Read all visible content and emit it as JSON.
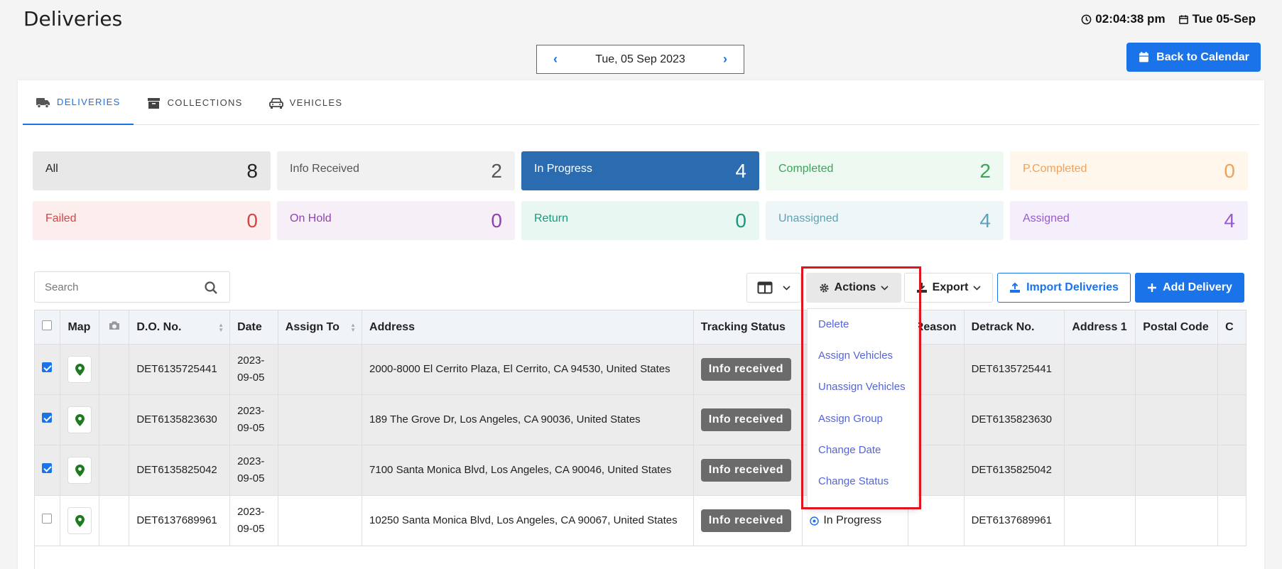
{
  "page": {
    "title": "Deliveries"
  },
  "header": {
    "time": "02:04:38 pm",
    "date": "Tue 05-Sep"
  },
  "date_nav": {
    "label": "Tue, 05 Sep 2023"
  },
  "back_button": {
    "label": "Back to Calendar"
  },
  "tabs": [
    {
      "label": "DELIVERIES",
      "active": true,
      "icon": "truck-icon"
    },
    {
      "label": "COLLECTIONS",
      "active": false,
      "icon": "archive-icon"
    },
    {
      "label": "VEHICLES",
      "active": false,
      "icon": "car-icon"
    }
  ],
  "stats": [
    {
      "label": "All",
      "count": "8",
      "bg": "#e8e8e8",
      "color": "#222222"
    },
    {
      "label": "Info Received",
      "count": "2",
      "bg": "#f1f1f1",
      "color": "#555555"
    },
    {
      "label": "In Progress",
      "count": "4",
      "bg": "#2b6cb0",
      "color": "#ffffff"
    },
    {
      "label": "Completed",
      "count": "2",
      "bg": "#eef9f1",
      "color": "#3aa557"
    },
    {
      "label": "P.Completed",
      "count": "0",
      "bg": "#fff6ec",
      "color": "#f0a25a"
    },
    {
      "label": "Failed",
      "count": "0",
      "bg": "#fdeeee",
      "color": "#d64545"
    },
    {
      "label": "On Hold",
      "count": "0",
      "bg": "#f7eff8",
      "color": "#8e44ad"
    },
    {
      "label": "Return",
      "count": "0",
      "bg": "#e9f7f3",
      "color": "#1a9a7a"
    },
    {
      "label": "Unassigned",
      "count": "4",
      "bg": "#eef6f7",
      "color": "#5ba3b8"
    },
    {
      "label": "Assigned",
      "count": "4",
      "bg": "#f4effb",
      "color": "#9b59d0"
    }
  ],
  "toolbar": {
    "search_placeholder": "Search",
    "actions_label": "Actions",
    "export_label": "Export",
    "import_label": "Import Deliveries",
    "add_label": "Add Delivery"
  },
  "actions_menu": [
    "Delete",
    "Assign Vehicles",
    "Unassign Vehicles",
    "Assign Group",
    "Change Date",
    "Change Status"
  ],
  "table": {
    "headers": [
      "Map",
      "D.O. No.",
      "Date",
      "Assign To",
      "Address",
      "Tracking Status",
      "Reason",
      "Detrack No.",
      "Address 1",
      "Postal Code",
      "C"
    ],
    "rows": [
      {
        "checked": true,
        "do_no": "DET6135725441",
        "date": "2023-09-05",
        "assign_to": "",
        "address": "2000-8000 El Cerrito Plaza, El Cerrito, CA 94530, United States",
        "tracking": "Info received",
        "status": "",
        "reason": "",
        "detrack": "DET6135725441"
      },
      {
        "checked": true,
        "do_no": "DET6135823630",
        "date": "2023-09-05",
        "assign_to": "",
        "address": "189 The Grove Dr, Los Angeles, CA 90036, United States",
        "tracking": "Info received",
        "status": "",
        "reason": "",
        "detrack": "DET6135823630"
      },
      {
        "checked": true,
        "do_no": "DET6135825042",
        "date": "2023-09-05",
        "assign_to": "",
        "address": "7100 Santa Monica Blvd, Los Angeles, CA 90046, United States",
        "tracking": "Info received",
        "status": "",
        "reason": "",
        "detrack": "DET6135825042"
      },
      {
        "checked": false,
        "do_no": "DET6137689961",
        "date": "2023-09-05",
        "assign_to": "",
        "address": "10250 Santa Monica Blvd, Los Angeles, CA 90067, United States",
        "tracking": "Info received",
        "status": "In Progress",
        "reason": "",
        "detrack": "DET6137689961"
      }
    ]
  },
  "colors": {
    "accent": "#1a73e8",
    "highlight": "#e0141e",
    "map_pin": "#1e7a1e"
  }
}
